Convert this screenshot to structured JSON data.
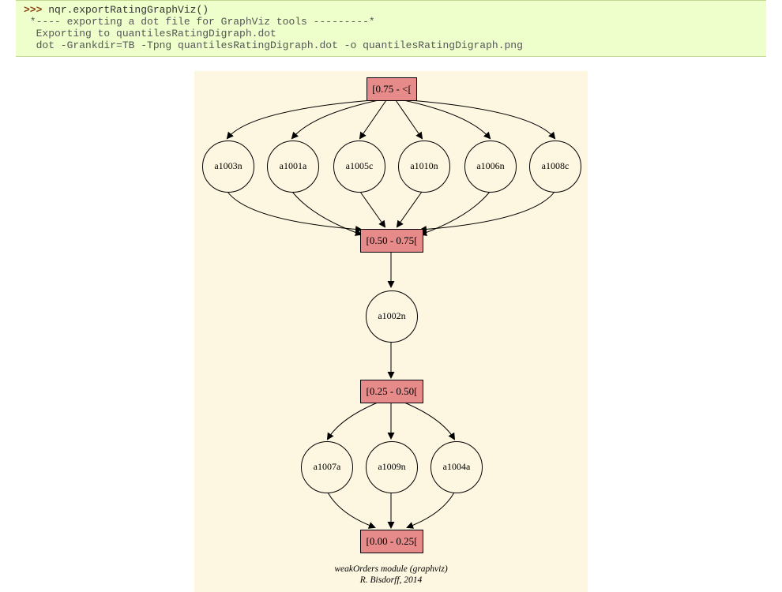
{
  "code": {
    "prompt": ">>> ",
    "command": "nqr.exportRatingGraphViz()",
    "line1": " *---- exporting a dot file for GraphViz tools ---------*",
    "line2": "  Exporting to quantilesRatingDigraph.dot",
    "line3": "  dot -Grankdir=TB -Tpng quantilesRatingDigraph.dot -o quantilesRatingDigraph.png"
  },
  "nodes": {
    "box1": "[0.75 - <[",
    "box2": "[0.50 - 0.75[",
    "box3": "[0.25 - 0.50[",
    "box4": "[0.00 - 0.25[",
    "c1": "a1003n",
    "c2": "a1001a",
    "c3": "a1005c",
    "c4": "a1010n",
    "c5": "a1006n",
    "c6": "a1008c",
    "c7": "a1002n",
    "c8": "a1007a",
    "c9": "a1009n",
    "c10": "a1004a"
  },
  "caption": {
    "line1": "weakOrders module (graphviz)",
    "line2": "R. Bisdorff, 2014"
  }
}
